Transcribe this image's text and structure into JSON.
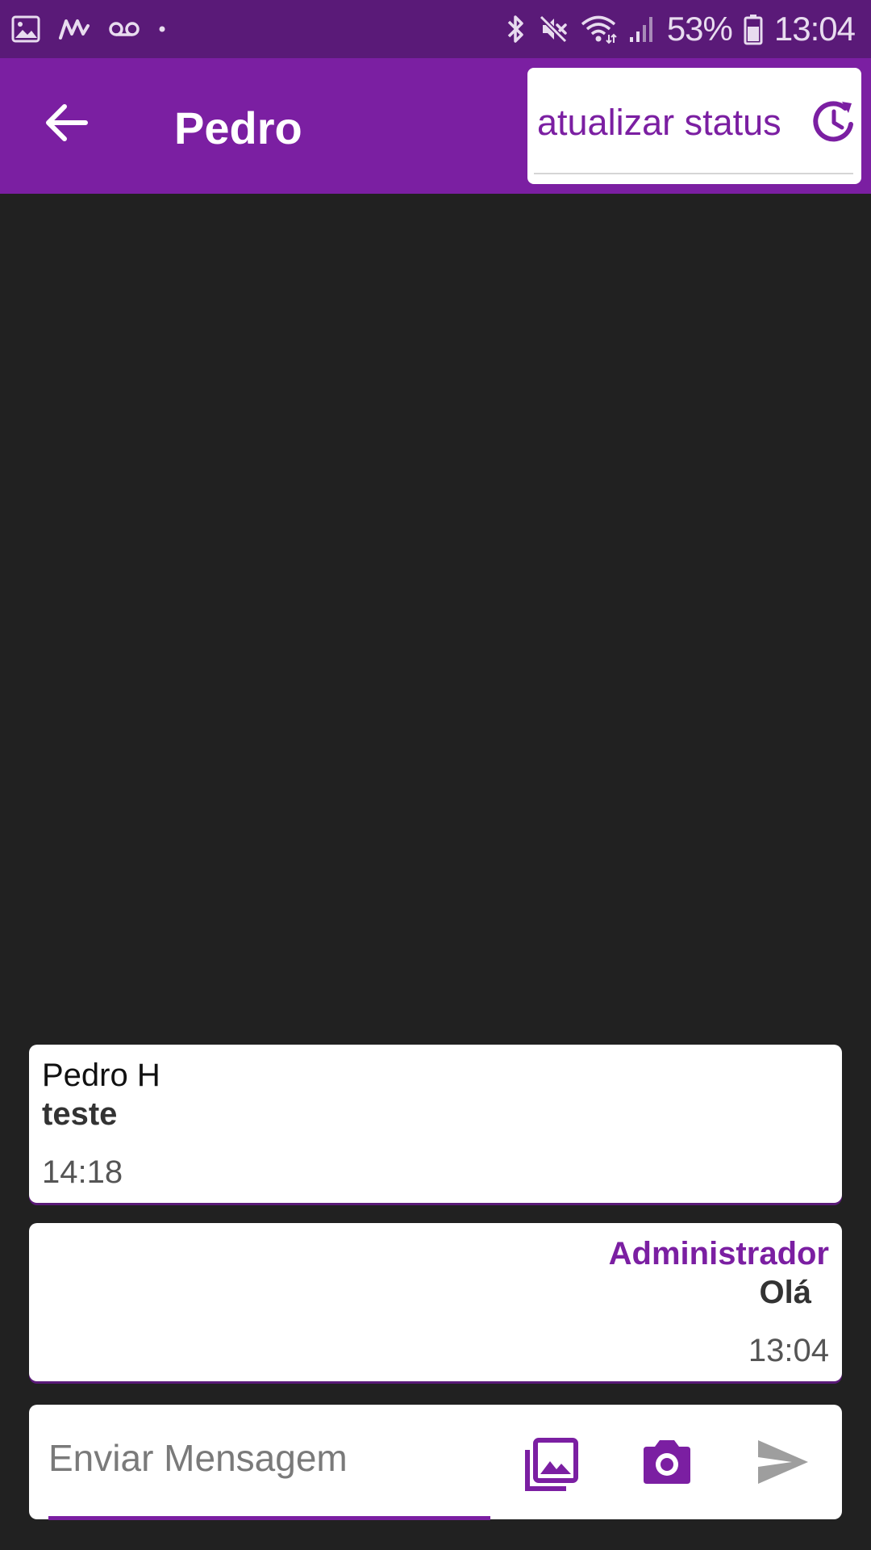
{
  "status_bar": {
    "battery_text": "53%",
    "time": "13:04",
    "icons_left": [
      "image-icon",
      "m-logo-icon",
      "voicemail-icon",
      "dot-icon"
    ],
    "icons_right": [
      "bluetooth-icon",
      "mute-icon",
      "wifi-icon",
      "signal-icon",
      "battery-icon"
    ]
  },
  "app_bar": {
    "title": "Pedro",
    "back_icon": "arrow-left-icon",
    "status_button_label": "atualizar status",
    "status_icon": "refresh-clock-icon"
  },
  "messages": [
    {
      "sender": "Pedro H",
      "text": "teste",
      "time": "14:18",
      "align": "left"
    },
    {
      "sender": "Administrador",
      "text": "Olá",
      "time": "13:04",
      "align": "right"
    }
  ],
  "composer": {
    "placeholder": "Enviar Mensagem",
    "value": "",
    "gallery_icon": "photo-library-icon",
    "camera_icon": "camera-icon",
    "send_icon": "send-icon"
  },
  "colors": {
    "primary": "#7b1fa2",
    "status_bar": "#5a1a78",
    "background": "#212121",
    "card": "#ffffff",
    "send_disabled": "#9e9e9e"
  }
}
